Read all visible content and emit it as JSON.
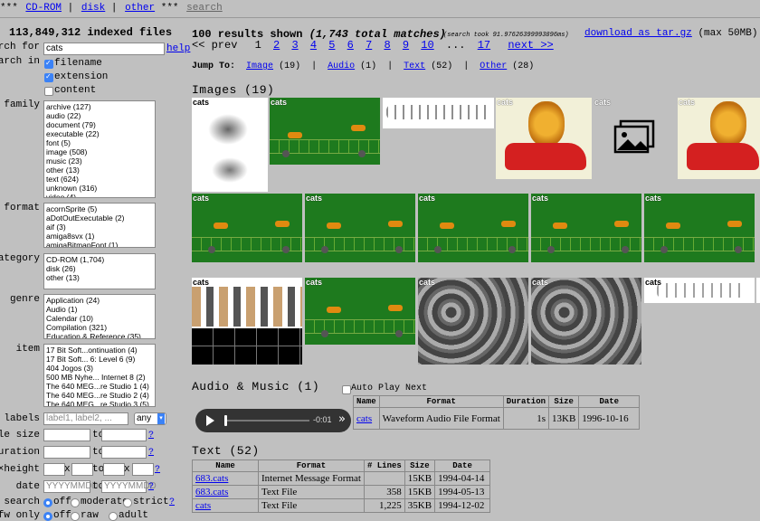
{
  "nav": {
    "stars_left": "***",
    "links": [
      "CD-ROM",
      "disk",
      "other"
    ],
    "sep": "|",
    "stars_right": "***",
    "search_link": "search"
  },
  "sidebar": {
    "indexed": "113,849,312 indexed files",
    "search_label": "search for",
    "search_value": "cats",
    "help": "help",
    "search_in_label": "search in",
    "search_in": [
      {
        "label": "filename",
        "checked": true
      },
      {
        "label": "extension",
        "checked": true
      },
      {
        "label": "content",
        "checked": false
      }
    ],
    "family_label": "family",
    "family": [
      "archive (127)",
      "audio (22)",
      "document (79)",
      "executable (22)",
      "font (5)",
      "image (508)",
      "music (23)",
      "other (13)",
      "text (624)",
      "unknown (316)",
      "video (4)"
    ],
    "format_label": "format",
    "format": [
      "acornSprite (5)",
      "aDotOutExecutable (2)",
      "aif (3)",
      "amiga8svx (1)",
      "amigaBitmapFont (1)"
    ],
    "category_label": "category",
    "category": [
      "CD-ROM (1,704)",
      "disk (26)",
      "other (13)"
    ],
    "genre_label": "genre",
    "genre": [
      "Application (24)",
      "Audio (1)",
      "Calendar (10)",
      "Compilation (321)",
      "Education & Reference (35)"
    ],
    "item_label": "item",
    "item": [
      "17 Bit Soft...ontinuation (4)",
      "17 Bit Soft... 6: Level 6 (9)",
      "404 Jogos (3)",
      "500 MB Nyhe... Internet 8 (2)",
      "The 640 MEG...re Studio 1 (4)",
      "The 640 MEG...re Studio 2 (4)",
      "The 640 MEG...re Studio 3 (5)"
    ],
    "labels_label": "labels",
    "labels_placeholder": "label1, label2, ...",
    "labels_select": "any",
    "filesize_label": "file size",
    "duration_label": "duration",
    "wh_label": "width×height",
    "date_label": "date",
    "date_placeholder": "YYYYMMDD",
    "to": "to",
    "x": "x",
    "q": "?",
    "fuzzy_label": "fuzzy search",
    "fuzzy": [
      "off",
      "moderate",
      "strict"
    ],
    "nsfw_label": "nsfw only",
    "nsfw": [
      "off",
      "raw",
      "adult"
    ]
  },
  "main": {
    "summary_a": "100 results shown",
    "summary_b": "(1,743 total matches)",
    "took": "(search took 91.97626399993896ms)",
    "download": "download as tar.gz",
    "download_note": "(max 50MB)",
    "prev": "<< prev",
    "pages": [
      "1",
      "2",
      "3",
      "4",
      "5",
      "6",
      "7",
      "8",
      "9",
      "10"
    ],
    "ellipsis": "...",
    "last": "17",
    "next": "next >>",
    "jump_label": "Jump To:",
    "jump": [
      {
        "label": "Image",
        "count": "(19)"
      },
      {
        "label": "Audio",
        "count": "(1)"
      },
      {
        "label": "Text",
        "count": "(52)"
      },
      {
        "label": "Other",
        "count": "(28)"
      }
    ],
    "images_title": "Images (19)",
    "thumb_caption": "cats",
    "audio_title": "Audio & Music (1)",
    "autoplay": "Auto Play Next",
    "audio_headers": [
      "Name",
      "Format",
      "Duration",
      "Size",
      "Date"
    ],
    "audio_row": [
      "cats",
      "Waveform Audio File Format",
      "1s",
      "13KB",
      "1996-10-16"
    ],
    "player_time": "-0:01",
    "text_title": "Text (52)",
    "text_headers": [
      "Name",
      "Format",
      "# Lines",
      "Size",
      "Date"
    ],
    "text_rows": [
      [
        "683.cats",
        "Internet Message Format",
        "",
        "15KB",
        "1994-04-14"
      ],
      [
        "683.cats",
        "Text File",
        "358",
        "15KB",
        "1994-05-13"
      ],
      [
        "cats",
        "Text File",
        "1,225",
        "35KB",
        "1994-12-02"
      ]
    ]
  }
}
